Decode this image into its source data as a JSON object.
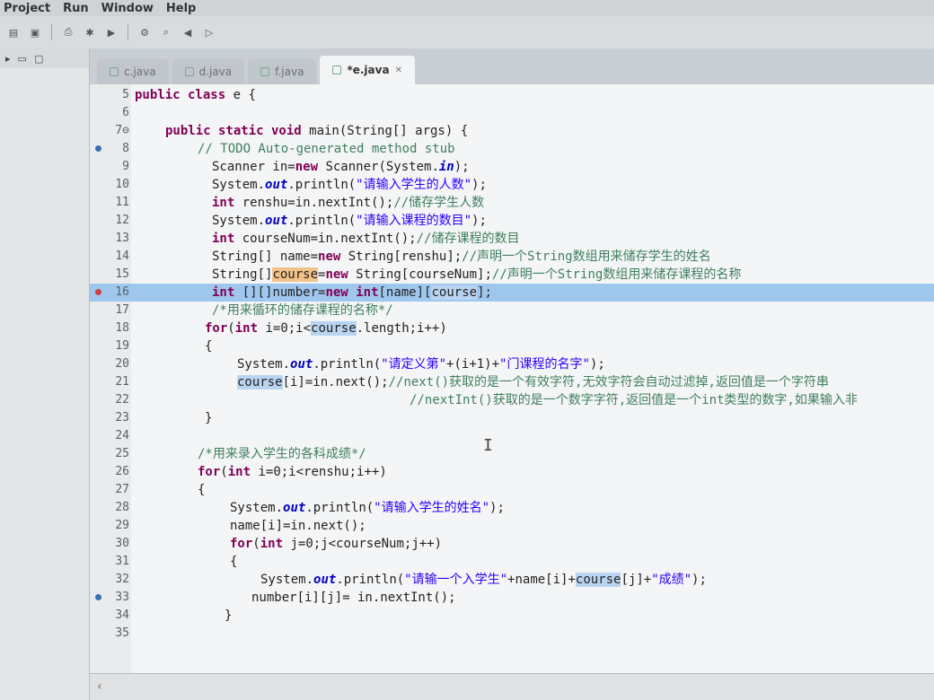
{
  "menu": [
    "Project",
    "Run",
    "Window",
    "Help"
  ],
  "tabs": [
    {
      "label": "c.java",
      "active": false
    },
    {
      "label": "d.java",
      "active": false
    },
    {
      "label": "f.java",
      "active": false
    },
    {
      "label": "*e.java",
      "active": true
    }
  ],
  "tab_close_glyph": "✕",
  "hscroll_arrow": "‹",
  "toolbar_icons": [
    "new-icon",
    "save-icon",
    "print-icon",
    "debug-icon",
    "run-icon",
    "external-tools-icon",
    "search-icon",
    "back-icon",
    "forward-icon"
  ],
  "code": {
    "l5": {
      "n": "5",
      "a": "public class",
      "b": " e {"
    },
    "l6": {
      "n": "6"
    },
    "l7": {
      "n": "7⊖",
      "a": "public static void",
      "b": " main(String[] args) {"
    },
    "l8": {
      "n": "8",
      "c": "// TODO Auto-generated method stub"
    },
    "l9": {
      "n": "9",
      "a": "Scanner in=",
      "k": "new",
      "b": " Scanner(System.",
      "f": "in",
      "e": ");"
    },
    "l10": {
      "n": "10",
      "a": "System.",
      "f": "out",
      "b": ".println(",
      "s": "\"请输入学生的人数\"",
      "e": ");"
    },
    "l11": {
      "n": "11",
      "k": "int",
      "b": " renshu=in.nextInt();",
      "c": "//储存学生人数"
    },
    "l12": {
      "n": "12",
      "a": "System.",
      "f": "out",
      "b": ".println(",
      "s": "\"请输入课程的数目\"",
      "e": ");"
    },
    "l13": {
      "n": "13",
      "k": "int",
      "b": " courseNum=in.nextInt();",
      "c": "//储存课程的数目"
    },
    "l14": {
      "n": "14",
      "a": "String[] name=",
      "k": "new",
      "b": " String[renshu];",
      "c": "//声明一个String数组用来储存学生的姓名"
    },
    "l15": {
      "n": "15",
      "a": "String[]",
      "h": "course",
      "b": "=",
      "k": "new",
      "e": " String[courseNum];",
      "c": "//声明一个String数组用来储存课程的名称"
    },
    "l16": {
      "n": "16",
      "k": "int",
      "a": " [][]number=",
      "k2": "new",
      "k3": " int",
      "b": "[name][",
      "h": "course",
      "e": "];"
    },
    "l17": {
      "n": "17",
      "c": "/*用来循环的储存课程的名称*/"
    },
    "l18": {
      "n": "18",
      "k": "for",
      "a": "(",
      "k2": "int",
      "b": " i=0;i<",
      "h": "course",
      "e": ".length;i++)"
    },
    "l19": {
      "n": "19",
      "a": "{"
    },
    "l20": {
      "n": "20",
      "a": "System.",
      "f": "out",
      "b": ".println(",
      "s": "\"请定义第\"",
      "e": "+(i+1)+",
      "s2": "\"门课程的名字\"",
      "z": ");"
    },
    "l21": {
      "n": "21",
      "h": "course",
      "a": "[i]=in.next();",
      "c": "//next()获取的是一个有效字符,无效字符会自动过滤掉,返回值是一个字符串"
    },
    "l22": {
      "n": "22",
      "c": "//nextInt()获取的是一个数字字符,返回值是一个int类型的数字,如果输入非"
    },
    "l23": {
      "n": "23",
      "a": "}"
    },
    "l24": {
      "n": "24"
    },
    "l25": {
      "n": "25",
      "c": "/*用来录入学生的各科成绩*/"
    },
    "l26": {
      "n": "26",
      "k": "for",
      "a": "(",
      "k2": "int",
      "b": " i=0;i<renshu;i++)"
    },
    "l27": {
      "n": "27",
      "a": "{"
    },
    "l28": {
      "n": "28",
      "a": "System.",
      "f": "out",
      "b": ".println(",
      "s": "\"请输入学生的姓名\"",
      "e": ");"
    },
    "l29": {
      "n": "29",
      "a": "name[i]=in.next();"
    },
    "l30": {
      "n": "30",
      "k": "for",
      "a": "(",
      "k2": "int",
      "b": " j=0;j<courseNum;j++)"
    },
    "l31": {
      "n": "31",
      "a": "{"
    },
    "l32": {
      "n": "32",
      "a": "System.",
      "f": "out",
      "b": ".println(",
      "s": "\"请输一个入学生\"",
      "e": "+name[i]+",
      "h": "course",
      "z": "[j]+",
      "s2": "\"成绩\"",
      "y": ");"
    },
    "l33": {
      "n": "33",
      "a": "number[i][j]= in.nextInt();"
    },
    "l34": {
      "n": "34",
      "a": "}"
    },
    "l35": {
      "n": "35"
    }
  },
  "colors": {
    "current_line": "#9fc7ee",
    "keyword": "#7f0055",
    "string": "#2a00ff",
    "comment": "#3f7f5f"
  }
}
